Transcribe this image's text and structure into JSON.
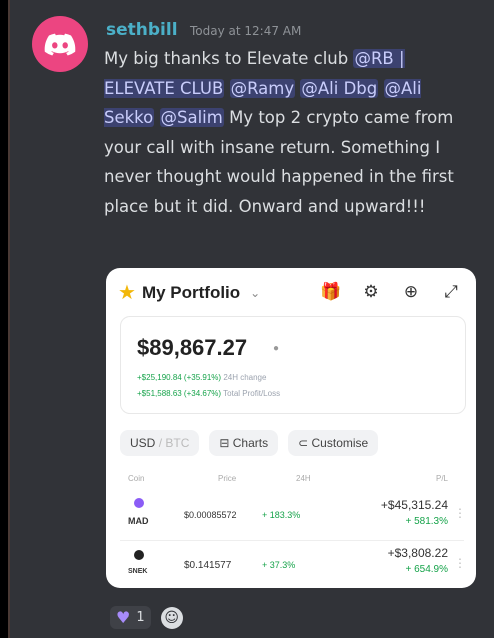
{
  "author": {
    "username": "sethbill",
    "timestamp": "Today at 12:47 AM",
    "avatar_icon": "discord-logo-icon"
  },
  "message": {
    "t1": "My big thanks to Elevate club ",
    "m1": "@RB | ELEVATE CLUB",
    "t2": " ",
    "m2": "@Ramy",
    "t3": " ",
    "m3": "@Ali Dbg",
    "t4": " ",
    "m4": "@Ali Sekko",
    "t5": " ",
    "m5": "@Salim",
    "t6": " My top 2 crypto came from your call with insane return. Something I never thought would happened in the first place but it did. Onward and upward!!!"
  },
  "portfolio": {
    "title": "My Portfolio",
    "balance": "$89,867.27",
    "stat1_value": "+$25,190.84 (+35.91%)",
    "stat1_label": "24H change",
    "stat2_value": "+$51,588.63 (+34.67%)",
    "stat2_label": "Total Profit/Loss",
    "currency": "USD",
    "currency_suffix": "/ BTC",
    "charts_label": "Charts",
    "customise_label": "Customise",
    "headers": {
      "coin": "Coin",
      "price": "Price",
      "change": "24H",
      "pnl": "P/L"
    },
    "rows": [
      {
        "name": "MAD",
        "price": "$0.00085572",
        "change": "+ 183.3%",
        "pnl": "+$45,315.24",
        "pnl_pct": "+ 581.3%"
      },
      {
        "name": "SNEK",
        "price": "$0.141577",
        "change": "+ 37.3%",
        "pnl": "+$3,808.22",
        "pnl_pct": "+ 654.9%"
      }
    ]
  },
  "reactions": {
    "count": "1"
  },
  "colors": {
    "background": "#313338",
    "username": "#4bb0c8",
    "avatar": "#ec4581",
    "mention_bg": "#3c4270",
    "gain": "#16a34a"
  }
}
